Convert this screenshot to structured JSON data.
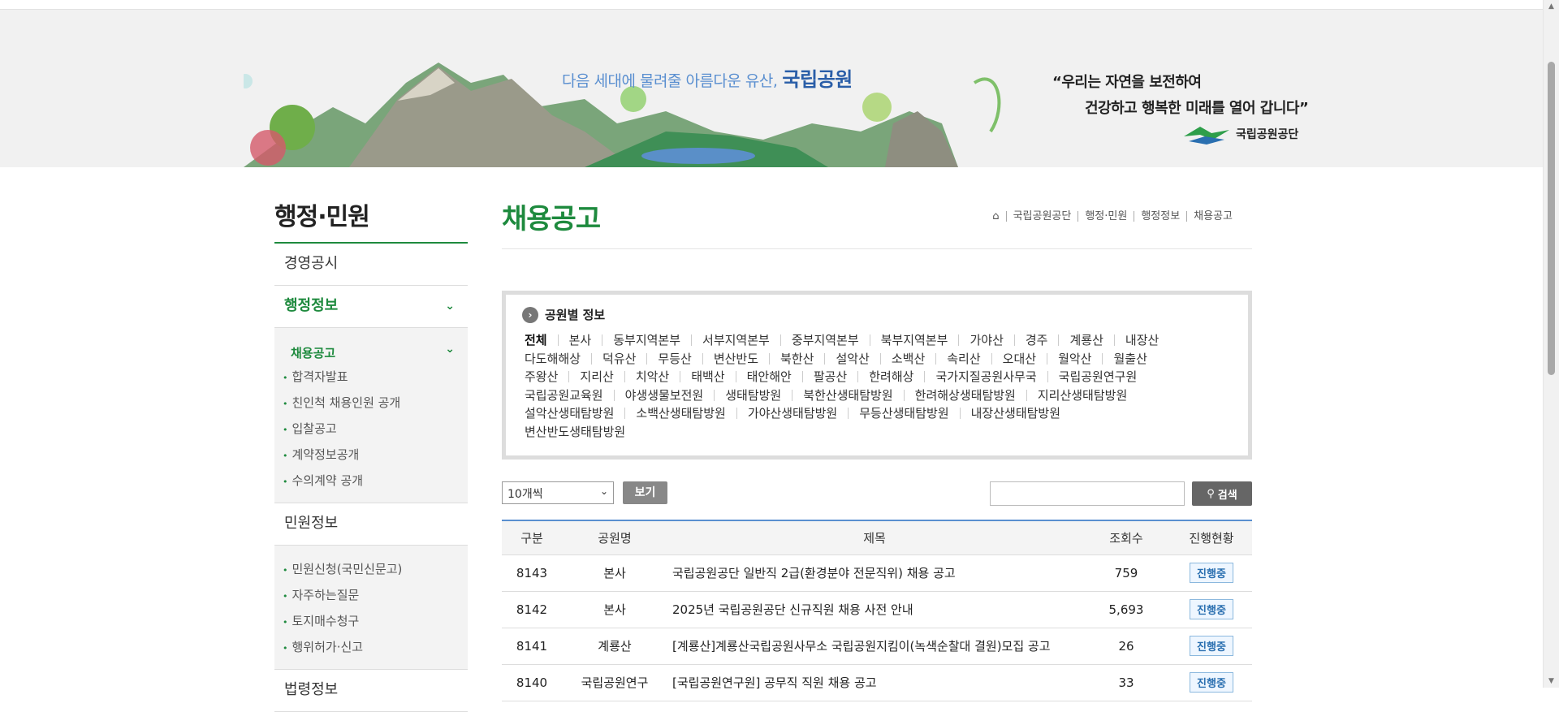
{
  "banner": {
    "slogan": "다음 세대에 물려줄 아름다운 유산,",
    "slogan_brand": "국립공원",
    "quote_line1": "“우리는 자연을 보전하여",
    "quote_line2": "건강하고 행복한 미래를 열어 갑니다”",
    "org_name": "국립공원공단"
  },
  "sidebar": {
    "title": "행정·민원",
    "menu": [
      {
        "label": "경영공시"
      },
      {
        "label": "행정정보"
      },
      {
        "label": "민원정보"
      },
      {
        "label": "법령정보"
      }
    ],
    "admin_sub_head": "채용공고",
    "admin_subs": [
      "합격자발표",
      "친인척 채용인원 공개",
      "입찰공고",
      "계약정보공개",
      "수의계약 공개"
    ],
    "civil_subs": [
      "민원신청(국민신문고)",
      "자주하는질문",
      "토지매수청구",
      "행위허가·신고"
    ]
  },
  "main": {
    "title": "채용공고",
    "breadcrumb": [
      "국립공원공단",
      "행정·민원",
      "행정정보",
      "채용공고"
    ]
  },
  "parks": {
    "title": "공원별 정보",
    "rows": [
      [
        "전체",
        "본사",
        "동부지역본부",
        "서부지역본부",
        "중부지역본부",
        "북부지역본부",
        "가야산",
        "경주",
        "계룡산",
        "내장산"
      ],
      [
        "다도해해상",
        "덕유산",
        "무등산",
        "변산반도",
        "북한산",
        "설악산",
        "소백산",
        "속리산",
        "오대산",
        "월악산",
        "월출산"
      ],
      [
        "주왕산",
        "지리산",
        "치악산",
        "태백산",
        "태안해안",
        "팔공산",
        "한려해상",
        "국가지질공원사무국",
        "국립공원연구원"
      ],
      [
        "국립공원교육원",
        "야생생물보전원",
        "생태탐방원",
        "북한산생태탐방원",
        "한려해상생태탐방원",
        "지리산생태탐방원"
      ],
      [
        "설악산생태탐방원",
        "소백산생태탐방원",
        "가야산생태탐방원",
        "무등산생태탐방원",
        "내장산생태탐방원"
      ],
      [
        "변산반도생태탐방원"
      ]
    ]
  },
  "controls": {
    "page_size": "10개씩",
    "view_label": "보기",
    "search_label": "검색"
  },
  "table": {
    "headers": [
      "구분",
      "공원명",
      "제목",
      "조회수",
      "진행현황"
    ],
    "rows": [
      {
        "no": "8143",
        "park": "본사",
        "title": "국립공원공단 일반직 2급(환경분야 전문직위) 채용 공고",
        "views": "759",
        "status": "진행중"
      },
      {
        "no": "8142",
        "park": "본사",
        "title": "2025년 국립공원공단 신규직원 채용 사전 안내",
        "views": "5,693",
        "status": "진행중"
      },
      {
        "no": "8141",
        "park": "계룡산",
        "title": "[계룡산]계룡산국립공원사무소 국립공원지킴이(녹색순찰대 결원)모집 공고",
        "views": "26",
        "status": "진행중"
      },
      {
        "no": "8140",
        "park": "국립공원연구",
        "title": "[국립공원연구원] 공무직 직원 채용 공고",
        "views": "33",
        "status": "진행중"
      }
    ]
  },
  "colors": {
    "accent": "#1e8a3e",
    "link_blue": "#2a6fb0",
    "banner_bg": "#f1f1f1"
  }
}
